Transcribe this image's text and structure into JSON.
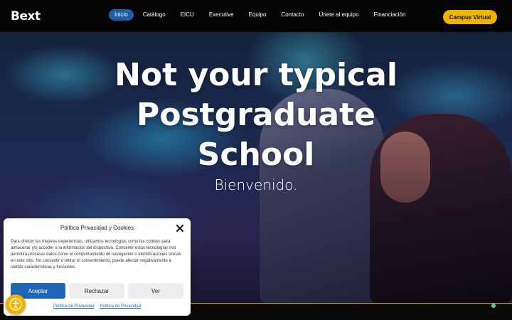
{
  "header": {
    "logo_text": "Bext",
    "nav": [
      {
        "label": "Inicio",
        "active": true
      },
      {
        "label": "Catálogo"
      },
      {
        "label": "EICU"
      },
      {
        "label": "Executive"
      },
      {
        "label": "Equipo"
      },
      {
        "label": "Contacto"
      },
      {
        "label": "Únete al equipo"
      },
      {
        "label": "Financiación"
      }
    ],
    "cta_label": "Campus Virtual"
  },
  "hero": {
    "title_line1": "Not your typical Postgraduate",
    "title_line2": "School",
    "subtitle": "Bienvenido."
  },
  "cookie": {
    "title": "Política Privacidad y Cookies",
    "body": "Para ofrecer las mejores experiencias, utilizamos tecnologías como las cookies para almacenar y/o acceder a la información del dispositivo. Consentir estas tecnologías nos permitirá procesar datos como el comportamiento de navegación o identificaciones únicas en este sitio. No consentir o retirar el consentimiento, puede afectar negativamente a ciertas características y funciones.",
    "accept_label": "Aceptar",
    "reject_label": "Rechazar",
    "view_label": "Ver",
    "link1": "Política de Privacidad",
    "link2": "Política de Privacidad"
  },
  "colors": {
    "accent_blue": "#1f66b8",
    "accent_yellow": "#f0b400",
    "header_bg": "#050505"
  },
  "icons": {
    "close": "close-icon",
    "accessibility": "accessibility-icon"
  }
}
